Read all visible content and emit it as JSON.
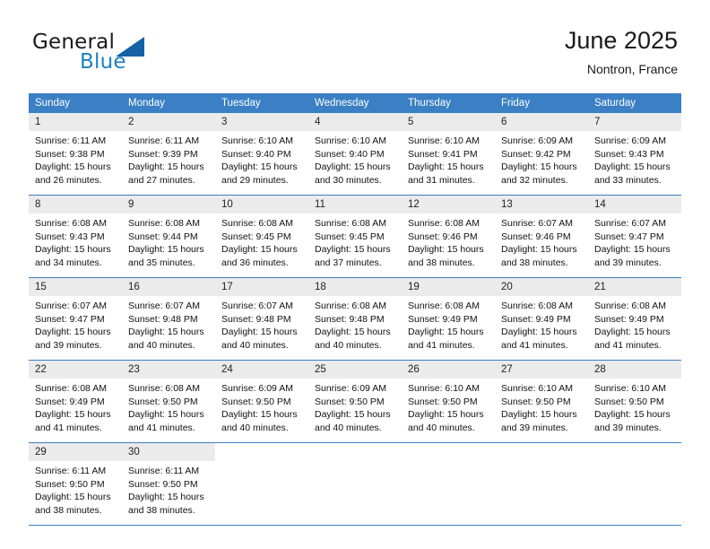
{
  "brand": {
    "word_one": "General",
    "word_two": "Blue",
    "flag_icon": "triangle-flag-icon"
  },
  "header": {
    "title": "June 2025",
    "location": "Nontron, France"
  },
  "calendar": {
    "weekday_headers": [
      "Sunday",
      "Monday",
      "Tuesday",
      "Wednesday",
      "Thursday",
      "Friday",
      "Saturday"
    ],
    "accent_color": "#3b7fc4",
    "daynum_band_color": "#ebebeb",
    "labels": {
      "sunrise": "Sunrise:",
      "sunset": "Sunset:",
      "daylight": "Daylight:"
    },
    "weeks": [
      [
        {
          "day": "1",
          "sunrise": "Sunrise: 6:11 AM",
          "sunset": "Sunset: 9:38 PM",
          "daylight_a": "Daylight: 15 hours",
          "daylight_b": "and 26 minutes."
        },
        {
          "day": "2",
          "sunrise": "Sunrise: 6:11 AM",
          "sunset": "Sunset: 9:39 PM",
          "daylight_a": "Daylight: 15 hours",
          "daylight_b": "and 27 minutes."
        },
        {
          "day": "3",
          "sunrise": "Sunrise: 6:10 AM",
          "sunset": "Sunset: 9:40 PM",
          "daylight_a": "Daylight: 15 hours",
          "daylight_b": "and 29 minutes."
        },
        {
          "day": "4",
          "sunrise": "Sunrise: 6:10 AM",
          "sunset": "Sunset: 9:40 PM",
          "daylight_a": "Daylight: 15 hours",
          "daylight_b": "and 30 minutes."
        },
        {
          "day": "5",
          "sunrise": "Sunrise: 6:10 AM",
          "sunset": "Sunset: 9:41 PM",
          "daylight_a": "Daylight: 15 hours",
          "daylight_b": "and 31 minutes."
        },
        {
          "day": "6",
          "sunrise": "Sunrise: 6:09 AM",
          "sunset": "Sunset: 9:42 PM",
          "daylight_a": "Daylight: 15 hours",
          "daylight_b": "and 32 minutes."
        },
        {
          "day": "7",
          "sunrise": "Sunrise: 6:09 AM",
          "sunset": "Sunset: 9:43 PM",
          "daylight_a": "Daylight: 15 hours",
          "daylight_b": "and 33 minutes."
        }
      ],
      [
        {
          "day": "8",
          "sunrise": "Sunrise: 6:08 AM",
          "sunset": "Sunset: 9:43 PM",
          "daylight_a": "Daylight: 15 hours",
          "daylight_b": "and 34 minutes."
        },
        {
          "day": "9",
          "sunrise": "Sunrise: 6:08 AM",
          "sunset": "Sunset: 9:44 PM",
          "daylight_a": "Daylight: 15 hours",
          "daylight_b": "and 35 minutes."
        },
        {
          "day": "10",
          "sunrise": "Sunrise: 6:08 AM",
          "sunset": "Sunset: 9:45 PM",
          "daylight_a": "Daylight: 15 hours",
          "daylight_b": "and 36 minutes."
        },
        {
          "day": "11",
          "sunrise": "Sunrise: 6:08 AM",
          "sunset": "Sunset: 9:45 PM",
          "daylight_a": "Daylight: 15 hours",
          "daylight_b": "and 37 minutes."
        },
        {
          "day": "12",
          "sunrise": "Sunrise: 6:08 AM",
          "sunset": "Sunset: 9:46 PM",
          "daylight_a": "Daylight: 15 hours",
          "daylight_b": "and 38 minutes."
        },
        {
          "day": "13",
          "sunrise": "Sunrise: 6:07 AM",
          "sunset": "Sunset: 9:46 PM",
          "daylight_a": "Daylight: 15 hours",
          "daylight_b": "and 38 minutes."
        },
        {
          "day": "14",
          "sunrise": "Sunrise: 6:07 AM",
          "sunset": "Sunset: 9:47 PM",
          "daylight_a": "Daylight: 15 hours",
          "daylight_b": "and 39 minutes."
        }
      ],
      [
        {
          "day": "15",
          "sunrise": "Sunrise: 6:07 AM",
          "sunset": "Sunset: 9:47 PM",
          "daylight_a": "Daylight: 15 hours",
          "daylight_b": "and 39 minutes."
        },
        {
          "day": "16",
          "sunrise": "Sunrise: 6:07 AM",
          "sunset": "Sunset: 9:48 PM",
          "daylight_a": "Daylight: 15 hours",
          "daylight_b": "and 40 minutes."
        },
        {
          "day": "17",
          "sunrise": "Sunrise: 6:07 AM",
          "sunset": "Sunset: 9:48 PM",
          "daylight_a": "Daylight: 15 hours",
          "daylight_b": "and 40 minutes."
        },
        {
          "day": "18",
          "sunrise": "Sunrise: 6:08 AM",
          "sunset": "Sunset: 9:48 PM",
          "daylight_a": "Daylight: 15 hours",
          "daylight_b": "and 40 minutes."
        },
        {
          "day": "19",
          "sunrise": "Sunrise: 6:08 AM",
          "sunset": "Sunset: 9:49 PM",
          "daylight_a": "Daylight: 15 hours",
          "daylight_b": "and 41 minutes."
        },
        {
          "day": "20",
          "sunrise": "Sunrise: 6:08 AM",
          "sunset": "Sunset: 9:49 PM",
          "daylight_a": "Daylight: 15 hours",
          "daylight_b": "and 41 minutes."
        },
        {
          "day": "21",
          "sunrise": "Sunrise: 6:08 AM",
          "sunset": "Sunset: 9:49 PM",
          "daylight_a": "Daylight: 15 hours",
          "daylight_b": "and 41 minutes."
        }
      ],
      [
        {
          "day": "22",
          "sunrise": "Sunrise: 6:08 AM",
          "sunset": "Sunset: 9:49 PM",
          "daylight_a": "Daylight: 15 hours",
          "daylight_b": "and 41 minutes."
        },
        {
          "day": "23",
          "sunrise": "Sunrise: 6:08 AM",
          "sunset": "Sunset: 9:50 PM",
          "daylight_a": "Daylight: 15 hours",
          "daylight_b": "and 41 minutes."
        },
        {
          "day": "24",
          "sunrise": "Sunrise: 6:09 AM",
          "sunset": "Sunset: 9:50 PM",
          "daylight_a": "Daylight: 15 hours",
          "daylight_b": "and 40 minutes."
        },
        {
          "day": "25",
          "sunrise": "Sunrise: 6:09 AM",
          "sunset": "Sunset: 9:50 PM",
          "daylight_a": "Daylight: 15 hours",
          "daylight_b": "and 40 minutes."
        },
        {
          "day": "26",
          "sunrise": "Sunrise: 6:10 AM",
          "sunset": "Sunset: 9:50 PM",
          "daylight_a": "Daylight: 15 hours",
          "daylight_b": "and 40 minutes."
        },
        {
          "day": "27",
          "sunrise": "Sunrise: 6:10 AM",
          "sunset": "Sunset: 9:50 PM",
          "daylight_a": "Daylight: 15 hours",
          "daylight_b": "and 39 minutes."
        },
        {
          "day": "28",
          "sunrise": "Sunrise: 6:10 AM",
          "sunset": "Sunset: 9:50 PM",
          "daylight_a": "Daylight: 15 hours",
          "daylight_b": "and 39 minutes."
        }
      ],
      [
        {
          "day": "29",
          "sunrise": "Sunrise: 6:11 AM",
          "sunset": "Sunset: 9:50 PM",
          "daylight_a": "Daylight: 15 hours",
          "daylight_b": "and 38 minutes."
        },
        {
          "day": "30",
          "sunrise": "Sunrise: 6:11 AM",
          "sunset": "Sunset: 9:50 PM",
          "daylight_a": "Daylight: 15 hours",
          "daylight_b": "and 38 minutes."
        },
        {
          "day": "",
          "sunrise": "",
          "sunset": "",
          "daylight_a": "",
          "daylight_b": ""
        },
        {
          "day": "",
          "sunrise": "",
          "sunset": "",
          "daylight_a": "",
          "daylight_b": ""
        },
        {
          "day": "",
          "sunrise": "",
          "sunset": "",
          "daylight_a": "",
          "daylight_b": ""
        },
        {
          "day": "",
          "sunrise": "",
          "sunset": "",
          "daylight_a": "",
          "daylight_b": ""
        },
        {
          "day": "",
          "sunrise": "",
          "sunset": "",
          "daylight_a": "",
          "daylight_b": ""
        }
      ]
    ]
  }
}
